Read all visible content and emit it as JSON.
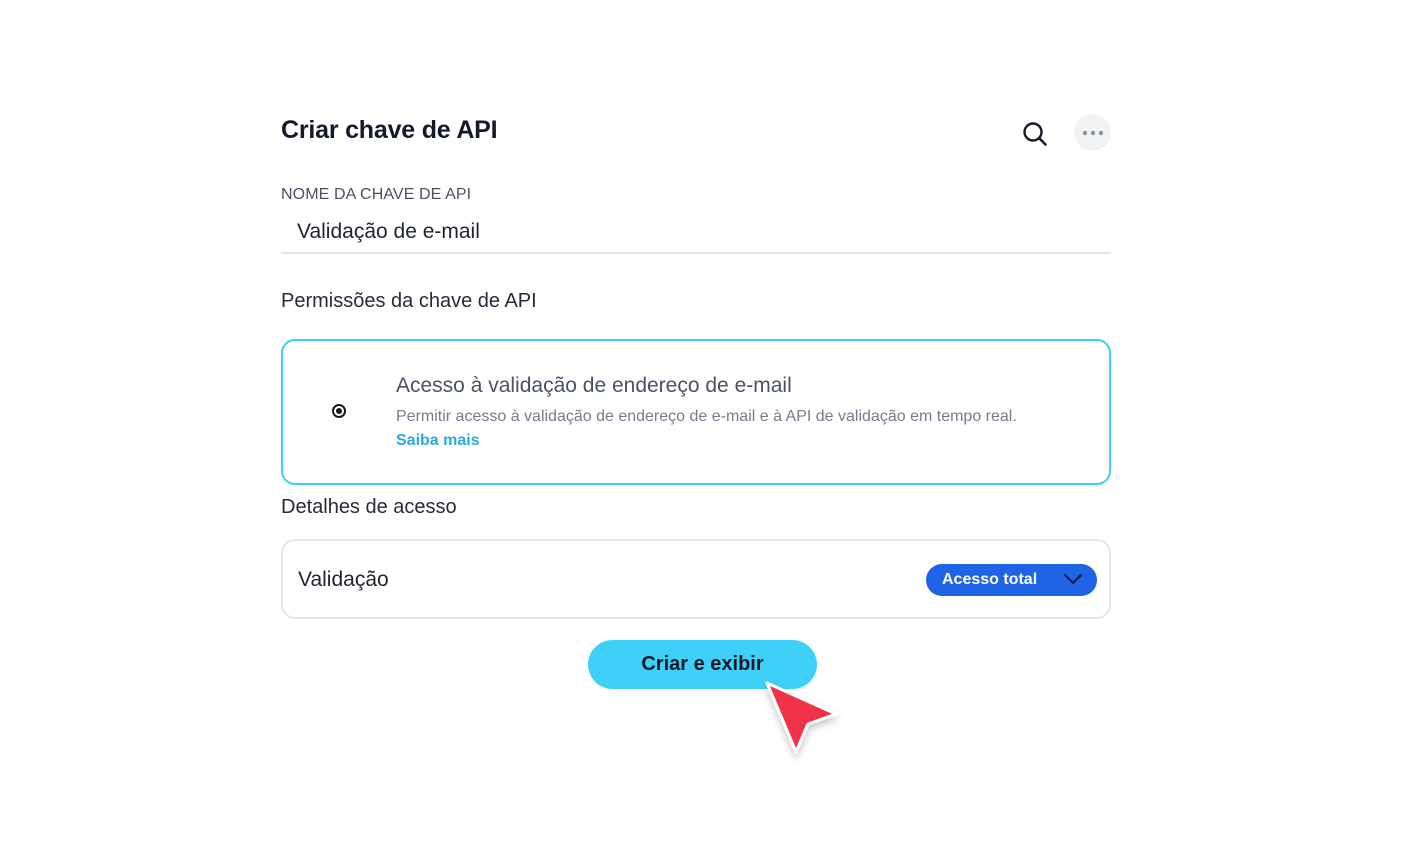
{
  "header": {
    "title": "Criar chave de API",
    "search_icon": "search-icon",
    "more_icon": "more-horizontal-icon"
  },
  "name_field": {
    "label": "NOME DA CHAVE DE API",
    "value": "Validação de e-mail"
  },
  "permissions": {
    "section_title": "Permissões da chave de API",
    "option": {
      "title": "Acesso à validação de endereço de e-mail",
      "description": "Permitir acesso à validação de endereço de e-mail e à API de validação em tempo real.",
      "link": "Saiba mais",
      "selected": true
    }
  },
  "access_details": {
    "section_title": "Detalhes de acesso",
    "row_label": "Validação",
    "selected_access": "Acesso total"
  },
  "submit": {
    "label": "Criar e exibir"
  },
  "colors": {
    "selected_border": "#40cdf2",
    "link": "#2aa9e0",
    "select_bg": "#1f63e6",
    "primary_button": "#3fd0f7",
    "cursor": "#f0304a"
  }
}
